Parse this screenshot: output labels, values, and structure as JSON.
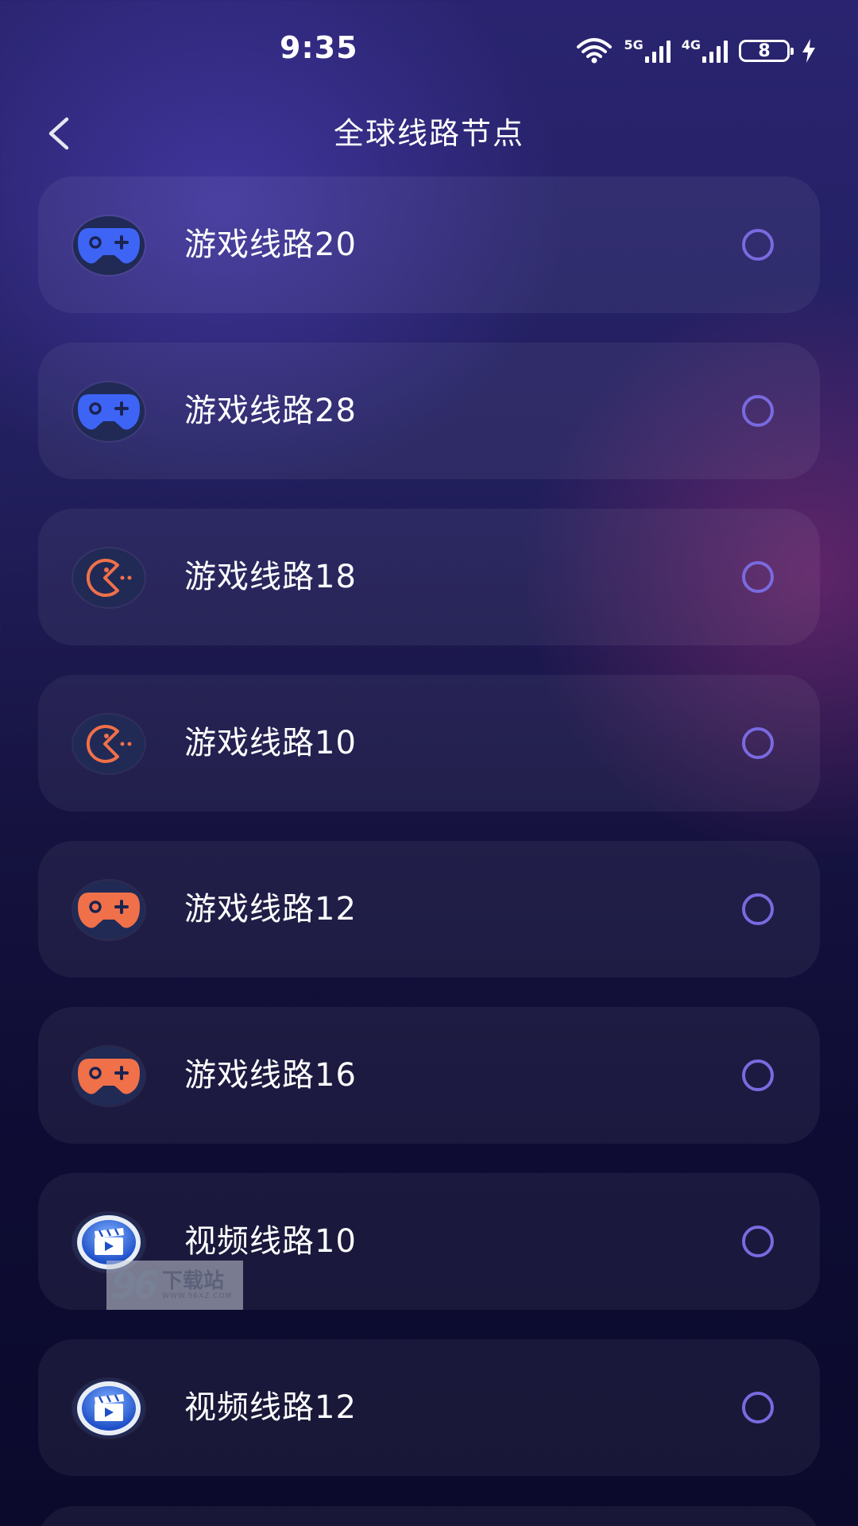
{
  "status_bar": {
    "time": "9:35",
    "network_5g": "5G",
    "network_4g": "4G",
    "battery_level": "8",
    "icons": [
      "wifi-icon",
      "signal-5g-icon",
      "signal-4g-icon",
      "battery-icon",
      "charging-icon"
    ]
  },
  "header": {
    "title": "全球线路节点",
    "back_icon": "chevron-left-icon"
  },
  "routes": [
    {
      "label": "游戏线路20",
      "icon": "gamepad-blue-icon",
      "selected": false
    },
    {
      "label": "游戏线路28",
      "icon": "gamepad-blue-icon",
      "selected": false
    },
    {
      "label": "游戏线路18",
      "icon": "pacman-orange-icon",
      "selected": false
    },
    {
      "label": "游戏线路10",
      "icon": "pacman-orange-icon",
      "selected": false
    },
    {
      "label": "游戏线路12",
      "icon": "gamepad-orange-icon",
      "selected": false
    },
    {
      "label": "游戏线路16",
      "icon": "gamepad-orange-icon",
      "selected": false
    },
    {
      "label": "视频线路10",
      "icon": "video-clapper-icon",
      "selected": false
    },
    {
      "label": "视频线路12",
      "icon": "video-clapper-icon",
      "selected": false
    }
  ],
  "watermark": {
    "digits": "96",
    "text": "下载站",
    "url": "WWW.96XZ.COM"
  },
  "colors": {
    "radio_border": "#7a6ae0",
    "gamepad_blue": "#3d64f5",
    "accent_orange": "#f0704a"
  }
}
